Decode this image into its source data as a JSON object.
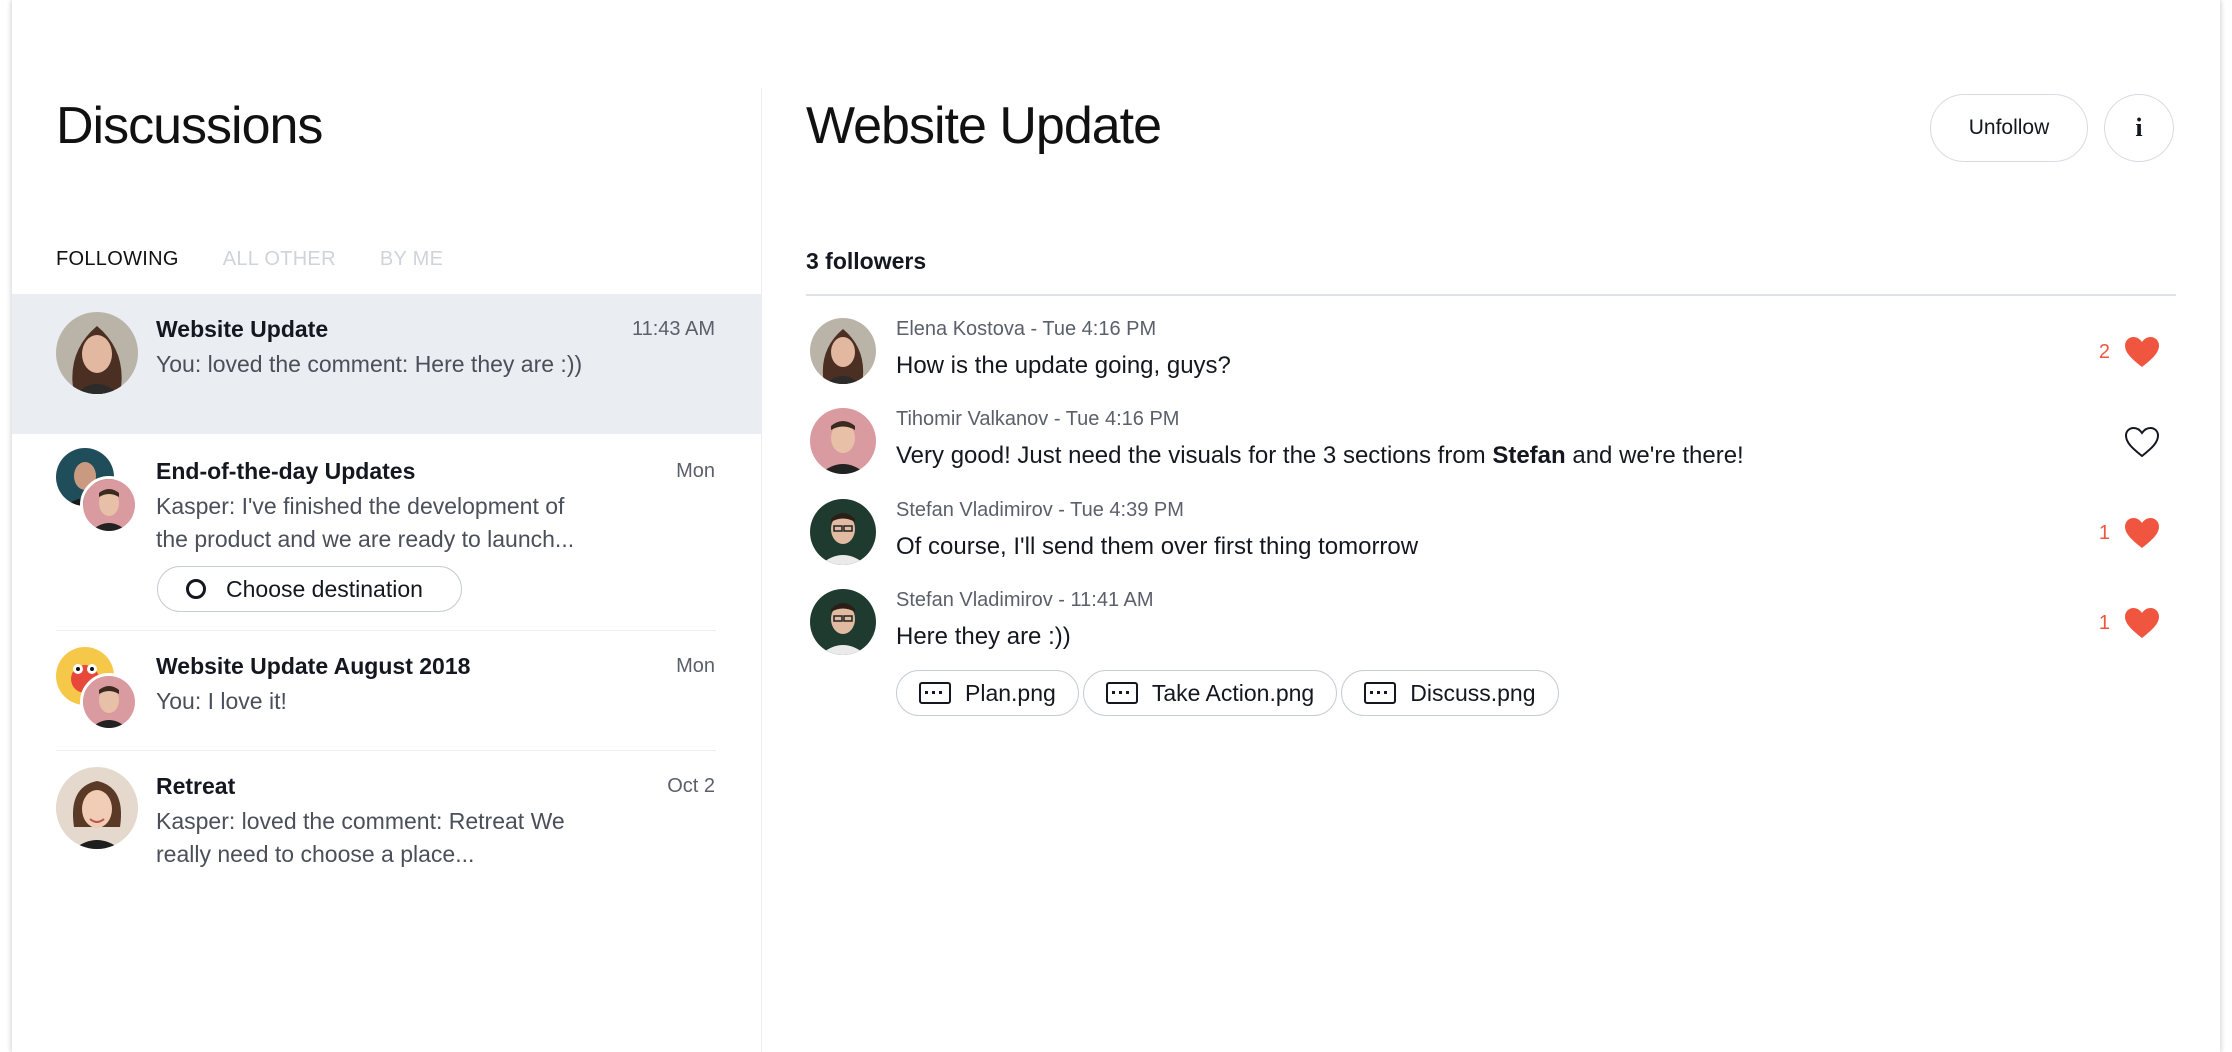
{
  "left": {
    "title": "Discussions",
    "tabs": [
      "FOLLOWING",
      "ALL OTHER",
      "BY ME"
    ],
    "threads": [
      {
        "title": "Website Update",
        "time": "11:43 AM",
        "snippet": "You: loved the comment: Here they are :))"
      },
      {
        "title": "End-of-the-day Updates",
        "time": "Mon",
        "snippet": "Kasper: I've finished the development of the product and we are ready to launch...",
        "action": "Choose destination"
      },
      {
        "title": "Website Update August 2018",
        "time": "Mon",
        "snippet": "You: I love it!"
      },
      {
        "title": "Retreat",
        "time": "Oct 2",
        "snippet": "Kasper: loved the comment: Retreat We really need to choose a place..."
      }
    ]
  },
  "right": {
    "title": "Website Update",
    "unfollow_label": "Unfollow",
    "info_label": "i",
    "followers": "3 followers",
    "comments": [
      {
        "meta": "Elena Kostova - Tue 4:16 PM",
        "text": "How is the update going, guys?",
        "likes": "2",
        "liked": true
      },
      {
        "meta": "Tihomir Valkanov - Tue 4:16 PM",
        "text_before": "Very good! Just need the visuals for the 3 sections from ",
        "mention": "Stefan",
        "text_after": " and we're there!",
        "likes": "",
        "liked": false
      },
      {
        "meta": "Stefan Vladimirov - Tue 4:39 PM",
        "text": "Of course, I'll send them over first thing tomorrow",
        "likes": "1",
        "liked": true
      },
      {
        "meta": "Stefan Vladimirov - 11:41 AM",
        "text": "Here they are :))",
        "likes": "1",
        "liked": true
      }
    ],
    "attachments": [
      "Plan.png",
      "Take Action.png",
      "Discuss.png"
    ]
  },
  "colors": {
    "accent": "#f0563f",
    "selected_bg": "#eaedf2"
  }
}
